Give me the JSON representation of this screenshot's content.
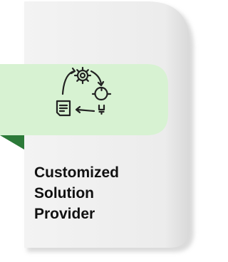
{
  "card": {
    "title_lines": [
      "Customized",
      "Solution",
      "Provider"
    ],
    "icon": "process-cycle-icon",
    "colors": {
      "card_background": "#eeeeee",
      "card_edge_shadow": "#c7c7c7",
      "banner_fill": "#d7f2d2",
      "banner_fold": "#2c7a39",
      "icon_stroke": "#222222",
      "title_text": "#111111"
    }
  }
}
